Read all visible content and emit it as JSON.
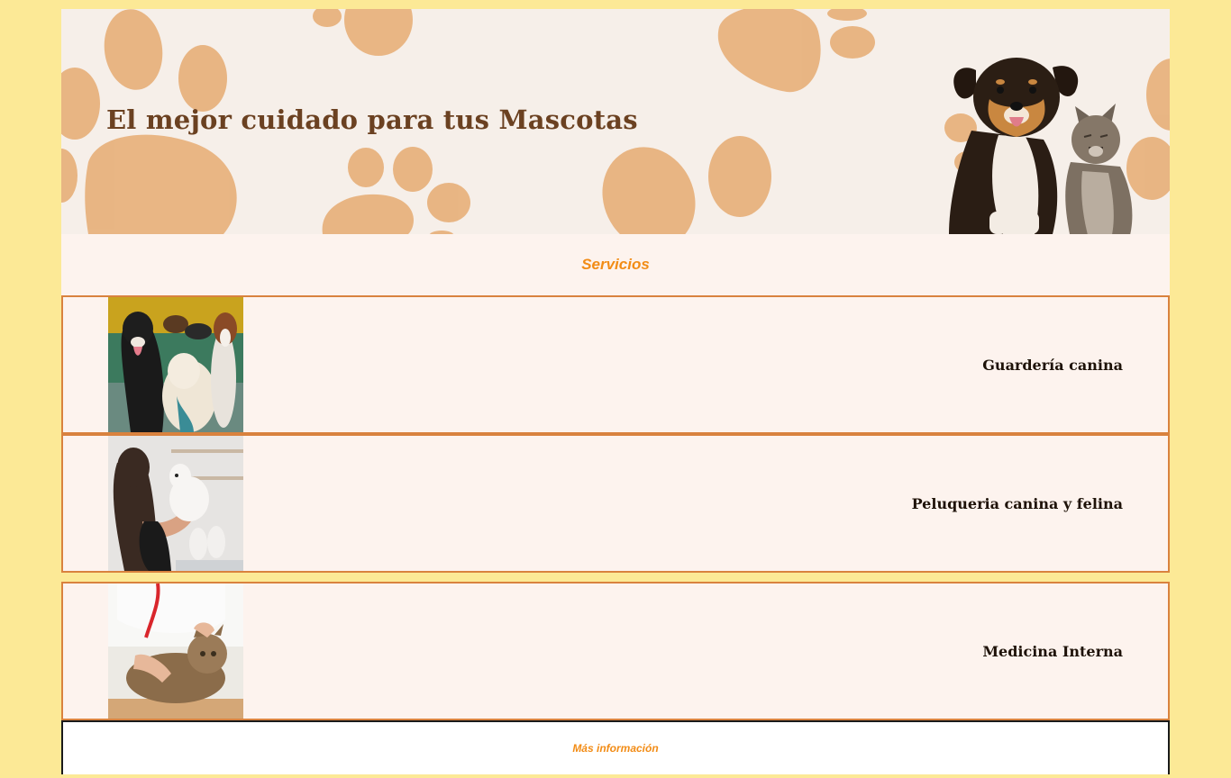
{
  "hero": {
    "title": "El mejor cuidado para tus Mascotas"
  },
  "services": {
    "title": "Servicios",
    "items": [
      {
        "label": "Guardería canina",
        "image": "dogs-group-photo"
      },
      {
        "label": "Peluqueria canina y felina",
        "image": "groomer-with-dog-photo"
      },
      {
        "label": "Medicina Interna",
        "image": "vet-examining-cat-photo"
      }
    ]
  },
  "footer": {
    "more_info_label": "Más información"
  },
  "colors": {
    "page_bg": "#fce996",
    "card_bg": "#fdf3ee",
    "card_border": "#d9823e",
    "accent_orange": "#f28c16",
    "title_brown": "#6b4121",
    "paw_color": "#e8b27e"
  }
}
